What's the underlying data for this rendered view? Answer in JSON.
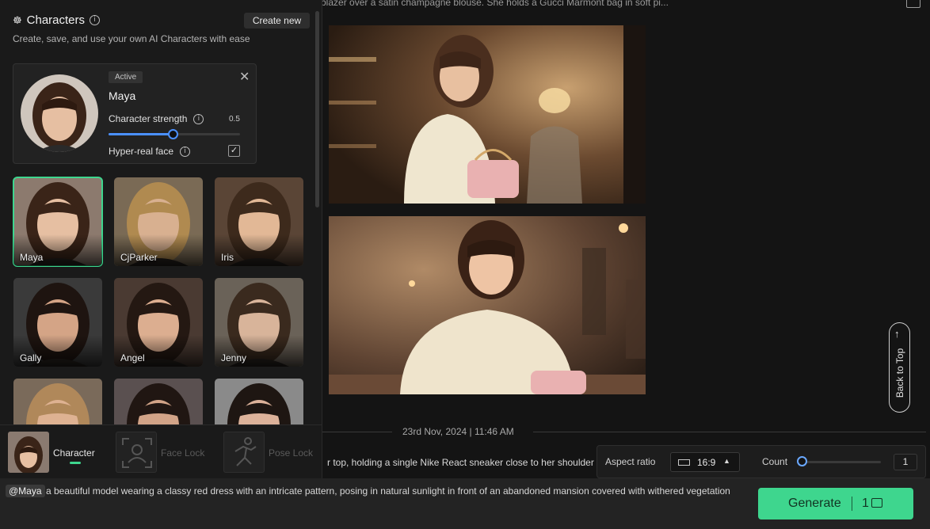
{
  "panel": {
    "title": "Characters",
    "create_button": "Create new",
    "subtitle": "Create, save, and use your own AI Characters with ease",
    "active": {
      "badge": "Active",
      "name": "Maya",
      "strength_label": "Character strength",
      "strength_value": "0.5",
      "strength_fraction": 0.45,
      "hyper_label": "Hyper-real face",
      "hyper_checked": true
    },
    "characters": [
      {
        "name": "Maya",
        "selected": true
      },
      {
        "name": "CjParker",
        "selected": false
      },
      {
        "name": "Iris",
        "selected": false
      },
      {
        "name": "Gally",
        "selected": false
      },
      {
        "name": "Angel",
        "selected": false
      },
      {
        "name": "Jenny",
        "selected": false
      },
      {
        "name": "",
        "selected": false
      },
      {
        "name": "",
        "selected": false
      },
      {
        "name": "",
        "selected": false
      }
    ],
    "tabs": [
      {
        "label": "Character",
        "active": true
      },
      {
        "label": "Face Lock",
        "active": false
      },
      {
        "label": "Pose Lock",
        "active": false
      }
    ]
  },
  "main": {
    "prompt_top": "blazer over a satin champagne blouse. She holds a Gucci Marmont bag in soft pi...",
    "date": "23rd Nov, 2024 | 11:46 AM",
    "prompt_mid": "r top, holding a single Nike React sneaker close to her shoulder",
    "back_to_top": "Back to Top"
  },
  "settings": {
    "aspect_label": "Aspect ratio",
    "aspect_value": "16:9",
    "count_label": "Count",
    "count_value": "1"
  },
  "input": {
    "mention": "@Maya",
    "prompt": "a beautiful model wearing a classy red dress with an intricate pattern, posing in natural sunlight in front of an abandoned mansion covered with withered vegetation",
    "generate_label": "Generate",
    "generate_count": "1"
  },
  "colors": {
    "accent_green": "#3ed68e",
    "slider_blue": "#4a90ff"
  }
}
